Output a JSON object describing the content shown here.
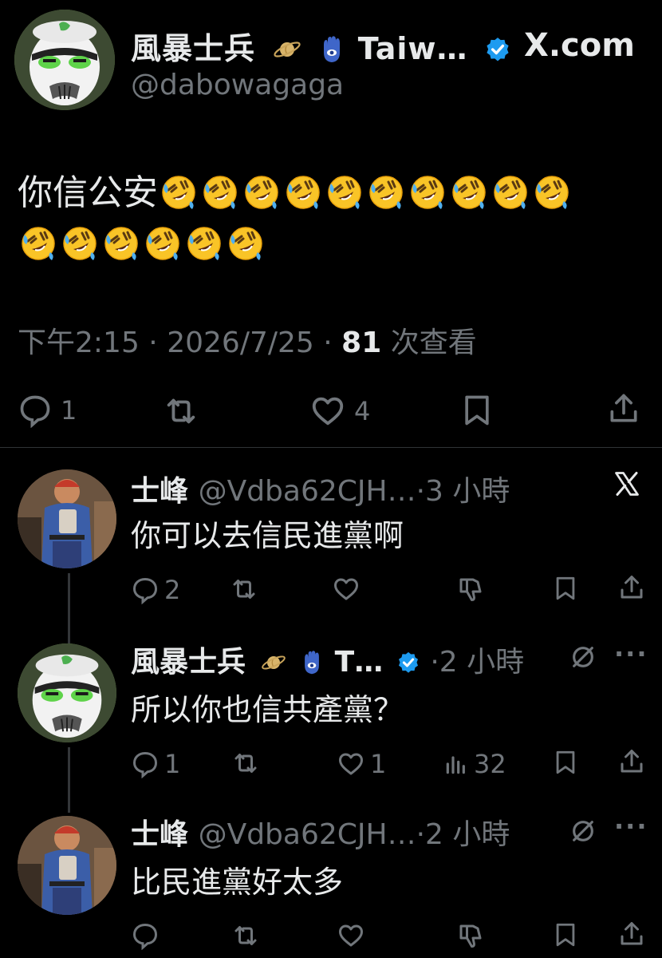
{
  "main_tweet": {
    "author_name": "風暴士兵",
    "author_name_truncated": "Taiw…",
    "handle": "@dabowagaga",
    "source_label": "X.com",
    "text": "你信公安",
    "emoji_count_line1": 10,
    "emoji_count_line2": 6,
    "emoji_icon": "rolling-on-floor-laughing-emoji",
    "time": "下午2:15",
    "date": "2026/7/25",
    "views_count": "81",
    "views_label": "次查看",
    "separator": "·",
    "actions": {
      "reply_count": "1",
      "retweet_count": "",
      "like_count": "4"
    }
  },
  "replies": [
    {
      "name": "士峰",
      "handle_time": "@Vdba62CJH…·3 小時",
      "text": "你可以去信民進黨啊",
      "reply_count": "2",
      "retweet_count": "",
      "like_count": "",
      "views_count": "",
      "corner_icon": "x-logo-icon"
    },
    {
      "name": "風暴士兵",
      "name_truncated": "T…",
      "handle_time": "·2 小時",
      "text": "所以你也信共產黨？",
      "reply_count": "1",
      "retweet_count": "",
      "like_count": "1",
      "views_count": "32",
      "corner_icon": "slash-circle-icon"
    },
    {
      "name": "士峰",
      "handle_time": "@Vdba62CJH…·2 小時",
      "text": "比民進黨好太多",
      "reply_count": "",
      "retweet_count": "",
      "like_count": "",
      "views_count": "",
      "corner_icon": "slash-circle-icon"
    }
  ],
  "colors": {
    "background": "#000000",
    "text": "#e7e9ea",
    "secondary": "#71767b",
    "verified": "#1d9bf0"
  }
}
